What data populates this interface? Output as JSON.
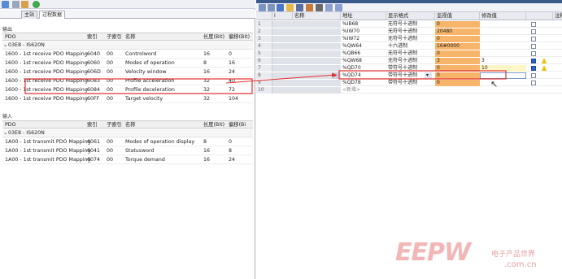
{
  "left": {
    "tabs": [
      "主站",
      "过程数据"
    ],
    "output": {
      "title": "输出",
      "headers": [
        "PDO",
        "索引",
        "子索引",
        "名称",
        "长度(Bit)",
        "偏移(Bit)"
      ],
      "group": "03E8 - IS620N",
      "rows": [
        [
          "1600 - 1st receive PDO Mapping",
          "6040",
          "00",
          "Controlword",
          "16",
          "0"
        ],
        [
          "1600 - 1st receive PDO Mapping",
          "6060",
          "00",
          "Modes of operation",
          "8",
          "16"
        ],
        [
          "1600 - 1st receive PDO Mapping",
          "606D",
          "00",
          "Velocity window",
          "16",
          "24"
        ],
        [
          "1600 - 1st receive PDO Mapping",
          "6083",
          "00",
          "Profile acceleration",
          "32",
          "40"
        ],
        [
          "1600 - 1st receive PDO Mapping",
          "6084",
          "00",
          "Profile deceleration",
          "32",
          "72"
        ],
        [
          "1600 - 1st receive PDO Mapping",
          "60FF",
          "00",
          "Target velocity",
          "32",
          "104"
        ]
      ]
    },
    "input": {
      "title": "输入",
      "headers": [
        "PDO",
        "索引",
        "子索引",
        "名称",
        "长度(Bit)",
        "偏移(Bi"
      ],
      "group": "03E8 - IS620N",
      "rows": [
        [
          "1A00 - 1st transmit PDO Mapping",
          "6061",
          "00",
          "Modes of operation display",
          "8",
          "0"
        ],
        [
          "1A00 - 1st transmit PDO Mapping",
          "6041",
          "00",
          "Statusword",
          "16",
          "8"
        ],
        [
          "1A00 - 1st transmit PDO Mapping",
          "6074",
          "00",
          "Torque demand",
          "16",
          "24"
        ]
      ]
    }
  },
  "right": {
    "headers": [
      "i",
      "名称",
      "地址",
      "显示格式",
      "监视值",
      "修改值",
      "",
      "注释"
    ],
    "rows": [
      {
        "n": "1",
        "addr": "%IB68",
        "fmt": "无符号十进制",
        "mon": "0",
        "mod": "",
        "chk": false,
        "warn": false
      },
      {
        "n": "2",
        "addr": "%IW70",
        "fmt": "无符号十进制",
        "mon": "20480",
        "mod": "",
        "chk": false,
        "warn": false
      },
      {
        "n": "3",
        "addr": "%IW72",
        "fmt": "无符号十进制",
        "mon": "0",
        "mod": "",
        "chk": false,
        "warn": false
      },
      {
        "n": "4",
        "addr": "%QW64",
        "fmt": "十六进制",
        "mon": "16#0000",
        "mod": "",
        "chk": false,
        "warn": false
      },
      {
        "n": "5",
        "addr": "%QB66",
        "fmt": "无符号十进制",
        "mon": "0",
        "mod": "",
        "chk": false,
        "warn": false
      },
      {
        "n": "6",
        "addr": "%QW68",
        "fmt": "无符号十进制",
        "mon": "3",
        "mod": "3",
        "chk": true,
        "warn": true
      },
      {
        "n": "7",
        "addr": "%QD70",
        "fmt": "带符号十进制",
        "mon": "0",
        "mod": "10",
        "chk": true,
        "warn": true
      },
      {
        "n": "8",
        "addr": "%QD74",
        "fmt": "带符号十进制",
        "mon": "0",
        "mod": "",
        "chk": false,
        "warn": false
      },
      {
        "n": "9",
        "addr": "%QD78",
        "fmt": "带符号十进制",
        "mon": "0",
        "mod": "",
        "chk": false,
        "warn": false
      },
      {
        "n": "10",
        "addr": "<新增>",
        "fmt": "",
        "mon": "",
        "mod": "",
        "chk": false,
        "warn": false
      }
    ]
  },
  "watermark": {
    "logo": "EEPW",
    "cn": "电子产品世界",
    "url": ".com.cn"
  },
  "colors": {
    "highlight": "#e23030",
    "monitor": "#f6b56a"
  }
}
